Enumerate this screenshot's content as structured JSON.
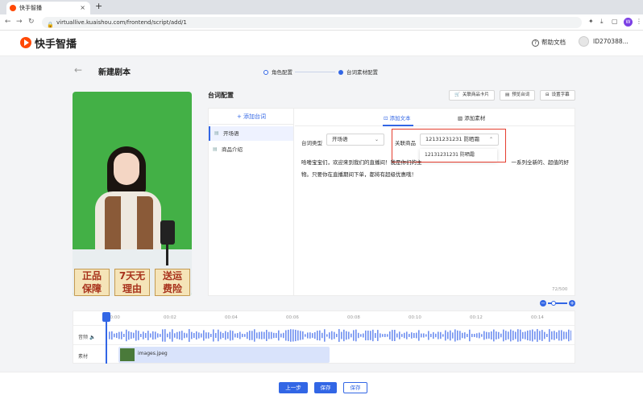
{
  "browser": {
    "tab_title": "快手智播",
    "tab_close": "×",
    "new_tab": "+",
    "url": "virtuallive.kuaishou.com/frontend/script/add/1",
    "profile_initial": "W"
  },
  "header": {
    "logo_text": "快手智播",
    "help_label": "帮助文档",
    "user_id": "ID270388..."
  },
  "page": {
    "title": "新建剧本",
    "back": "←",
    "steps": [
      "角色配置",
      "台词素材配置"
    ]
  },
  "preview": {
    "banners": [
      "正品\n保障",
      "7天无\n理由",
      "送运\n费险"
    ]
  },
  "script_panel": {
    "title": "台词配置",
    "toolbar": [
      "关联商品卡片",
      "预览台词",
      "设置字幕"
    ],
    "add_line": "+ 添加台词",
    "lines": [
      "开场语",
      "商品介绍"
    ],
    "tabs": [
      "添加文本",
      "添加素材"
    ],
    "type_label": "台词类型",
    "type_value": "开场语",
    "product_label": "关联商品",
    "product_value": "12131231231 防晒霜",
    "dropdown_option": "12131231231 防晒霜",
    "text_line1": "哈喽宝宝们，欢迎来到我们的直播间！我是你们的主",
    "text_line1_end": "一系列全新的、超值的好",
    "text_line2": "物。只要你在直播期间下单，都将有超级优惠哦！",
    "counter": "72/500"
  },
  "timeline": {
    "ticks": [
      "00:00",
      "00:02",
      "00:04",
      "00:06",
      "00:08",
      "00:10",
      "00:12",
      "00:14"
    ],
    "audio_label": "音频",
    "material_label": "素材",
    "clip_name": "images.jpeg"
  },
  "footer": {
    "prev": "上一步",
    "save_primary": "保存",
    "save_secondary": "保存"
  }
}
